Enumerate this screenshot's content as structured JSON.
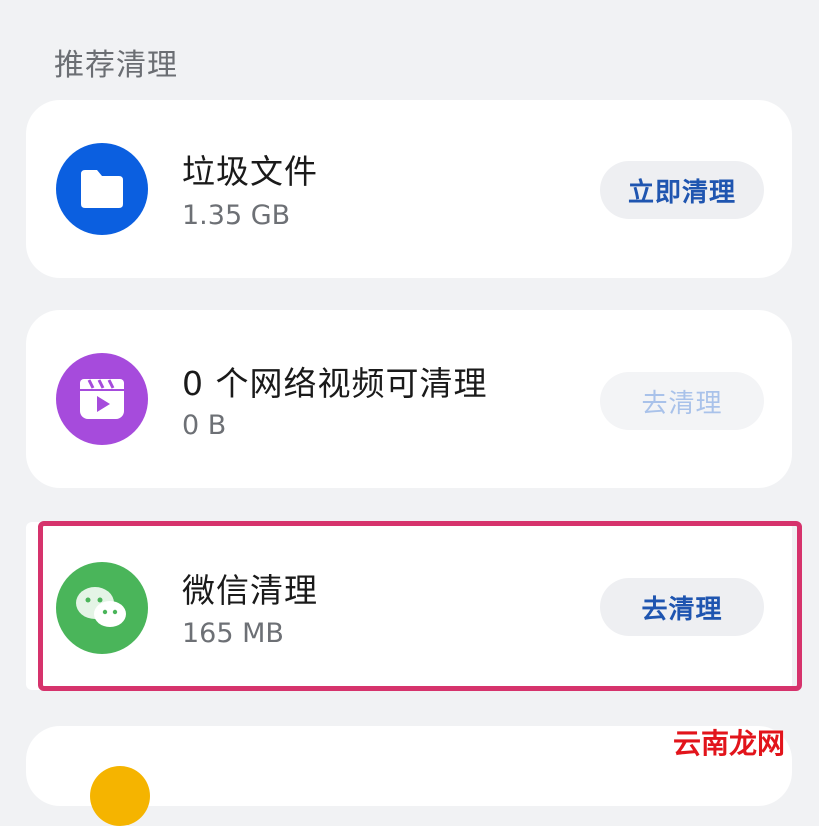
{
  "section": {
    "title": "推荐清理"
  },
  "items": [
    {
      "title": "垃圾文件",
      "size": "1.35 GB",
      "action": "立即清理",
      "icon": "folder-icon",
      "icon_color": "#0b5fe0",
      "enabled": true
    },
    {
      "title": "0 个网络视频可清理",
      "size": "0 B",
      "action": "去清理",
      "icon": "video-icon",
      "icon_color": "#a64bdc",
      "enabled": false
    },
    {
      "title": "微信清理",
      "size": "165 MB",
      "action": "去清理",
      "icon": "wechat-icon",
      "icon_color": "#4ab55a",
      "enabled": true,
      "highlighted": true
    }
  ],
  "watermark": "云南龙网",
  "colors": {
    "accent": "#1f55b0",
    "highlight_border": "#d6336c",
    "background": "#f1f2f4"
  }
}
